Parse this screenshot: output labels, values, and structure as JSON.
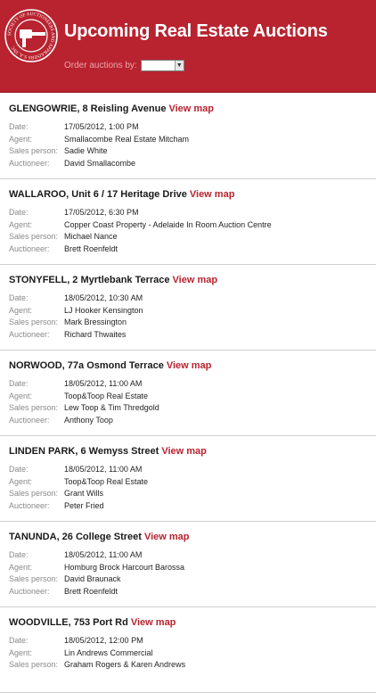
{
  "header": {
    "title": "Upcoming Real Estate Auctions",
    "order_label": "Order auctions by:",
    "order_value": "",
    "logo_text": "SOCIETY OF AUCTIONEERS AND APPRAISERS S.A. INC"
  },
  "labels": {
    "date": "Date:",
    "agent": "Agent:",
    "sales": "Sales person:",
    "auctioneer": "Auctioneer:"
  },
  "map_link": "View map",
  "auctions": [
    {
      "title": "GLENGOWRIE, 8 Reisling Avenue",
      "date": "17/05/2012, 1:00 PM",
      "agent": "Smallacombe Real Estate Mitcham",
      "sales": "Sadie White",
      "auctioneer": "David Smallacombe"
    },
    {
      "title": "WALLAROO, Unit 6 / 17 Heritage Drive",
      "date": "17/05/2012, 6:30 PM",
      "agent": "Copper Coast Property - Adelaide In Room Auction Centre",
      "sales": "Michael Nance",
      "auctioneer": "Brett Roenfeldt"
    },
    {
      "title": "STONYFELL, 2 Myrtlebank Terrace",
      "date": "18/05/2012, 10:30 AM",
      "agent": "LJ Hooker Kensington",
      "sales": "Mark Bressington",
      "auctioneer": "Richard Thwaites"
    },
    {
      "title": "NORWOOD, 77a Osmond Terrace",
      "date": "18/05/2012, 11:00 AM",
      "agent": "Toop&Toop Real Estate",
      "sales": "Lew Toop & Tim Thredgold",
      "auctioneer": "Anthony Toop"
    },
    {
      "title": "LINDEN PARK, 6 Wemyss Street",
      "date": "18/05/2012, 11:00 AM",
      "agent": "Toop&Toop Real Estate",
      "sales": "Grant Wills",
      "auctioneer": "Peter Fried"
    },
    {
      "title": "TANUNDA, 26 College Street",
      "date": "18/05/2012, 11:00 AM",
      "agent": "Homburg Brock Harcourt Barossa",
      "sales": "David Braunack",
      "auctioneer": "Brett Roenfeldt"
    },
    {
      "title": "WOODVILLE, 753 Port Rd",
      "date": "18/05/2012, 12:00 PM",
      "agent": "Lin Andrews Commercial",
      "sales": "Graham Rogers & Karen Andrews",
      "auctioneer": ""
    }
  ],
  "colors": {
    "brand": "#b8232f",
    "label": "#8a8a8a"
  }
}
